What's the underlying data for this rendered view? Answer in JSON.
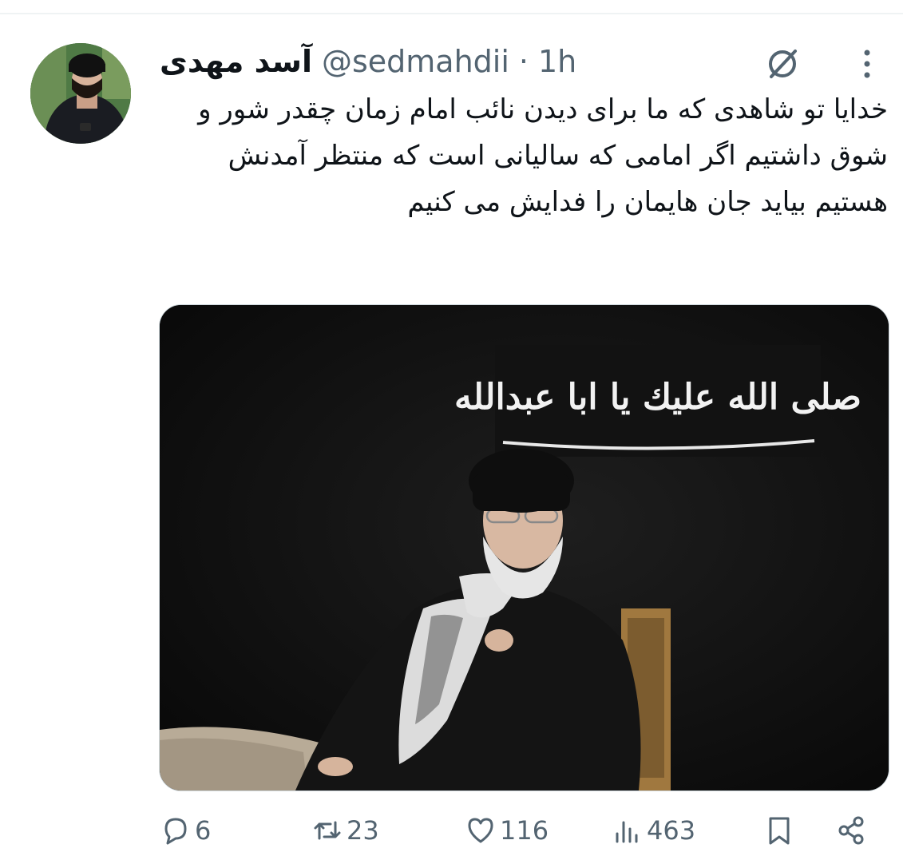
{
  "tweet": {
    "display_name": "آسد مهدی",
    "handle": "@sedmahdii",
    "separator": "·",
    "time": "1h",
    "text": "خدایا تو شاهدی که ما برای دیدن نائب امام زمان چقدر شور و شوق داشتیم اگر امامی که سالیانی است که منتظر آمدنش هستیم بیاید جان هایمان را فدایش می کنیم",
    "media": {
      "banner_text": "صلى الله عليك يا ابا عبدالله"
    }
  },
  "icons": {
    "avatar": "avatar",
    "grok": "grok-icon",
    "more": "more-icon",
    "reply": "reply-icon",
    "retweet": "retweet-icon",
    "like": "heart-icon",
    "views": "views-icon",
    "bookmark": "bookmark-icon",
    "share": "share-icon"
  },
  "actions": {
    "replies": "6",
    "retweets": "23",
    "likes": "116",
    "views": "463"
  },
  "colors": {
    "text_primary": "#0f1419",
    "text_secondary": "#536471",
    "divider": "#eff3f4"
  }
}
